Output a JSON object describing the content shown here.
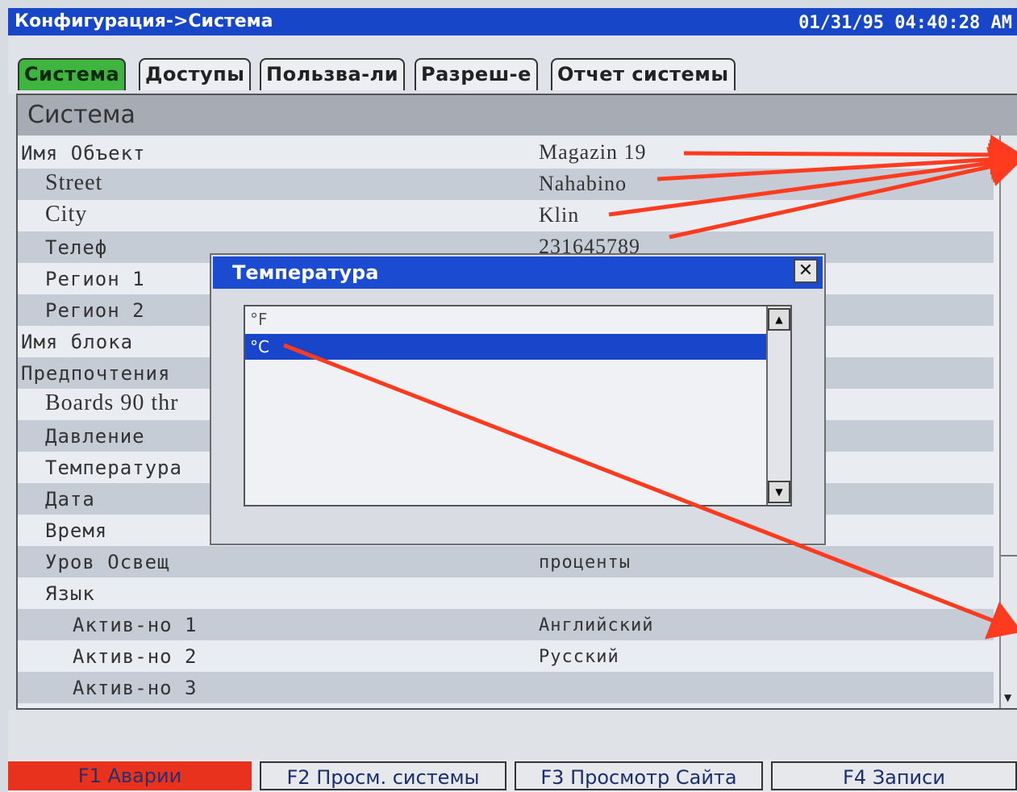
{
  "titlebar": {
    "title": "Конфигурация->Система",
    "clock": "01/31/95 04:40:28 AM"
  },
  "tabs": [
    {
      "label": "Система",
      "active": true
    },
    {
      "label": "Доступы",
      "active": false
    },
    {
      "label": "Пользва-ли",
      "active": false
    },
    {
      "label": "Разреш-е",
      "active": false
    },
    {
      "label": "Отчет системы",
      "active": false
    }
  ],
  "panel": {
    "header": "Система",
    "rows": [
      {
        "label": "Имя Объект",
        "value": "Magazin 19"
      },
      {
        "label": "Street",
        "value": "Nahabino"
      },
      {
        "label": "City",
        "value": "Klin"
      },
      {
        "label": "Телеф",
        "value": "231645789"
      },
      {
        "label": "Регион 1",
        "value": ""
      },
      {
        "label": "Регион 2",
        "value": ""
      },
      {
        "label": "Имя блока",
        "value": ""
      },
      {
        "label": "Предпочтения",
        "value": ""
      },
      {
        "label": "Boards 90 thr",
        "value": ""
      },
      {
        "label": "Давление",
        "value": ""
      },
      {
        "label": "Температура",
        "value": ""
      },
      {
        "label": "Дата",
        "value": ""
      },
      {
        "label": "Время",
        "value": ""
      },
      {
        "label": "Уров Освещ",
        "value": "проценты"
      },
      {
        "label": "Язык",
        "value": ""
      },
      {
        "label": "Актив-но 1",
        "value": "Английский"
      },
      {
        "label": "Актив-но 2",
        "value": "Русский"
      },
      {
        "label": "Актив-но 3",
        "value": ""
      }
    ]
  },
  "dialog": {
    "title": "Температура",
    "close_glyph": "✕",
    "options": [
      {
        "label": "°F",
        "selected": false
      },
      {
        "label": "°C",
        "selected": true
      }
    ]
  },
  "fkeys": [
    {
      "label": "F1 Аварии"
    },
    {
      "label": "F2 Просм. системы"
    },
    {
      "label": "F3 Просмотр Сайта"
    },
    {
      "label": "F4 Записи"
    }
  ],
  "colors": {
    "titlebar": "#1747c8",
    "active_tab": "#3fb53f",
    "alarm_key": "#e8321e",
    "annotation": "#ff3b1f"
  }
}
